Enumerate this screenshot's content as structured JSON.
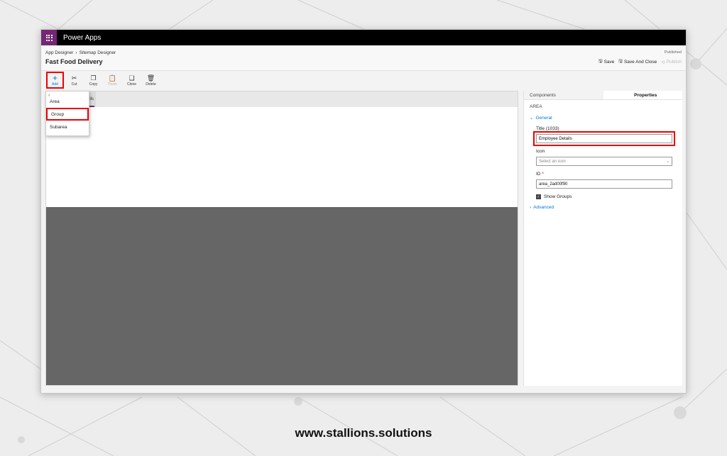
{
  "app": {
    "name": "Power Apps"
  },
  "header": {
    "breadcrumb": [
      "App Designer",
      "Sitemap Designer"
    ],
    "title": "Fast Food Delivery",
    "status": "Published",
    "actions": {
      "save": "Save",
      "save_and_close": "Save And Close",
      "publish": "Publish"
    }
  },
  "toolbar": {
    "add": "Add",
    "cut": "Cut",
    "copy": "Copy",
    "paste": "Paste",
    "clone": "Clone",
    "delete": "Delete"
  },
  "add_menu": {
    "items": [
      "Area",
      "Group",
      "Subarea"
    ],
    "highlighted": "Group"
  },
  "canvas": {
    "area_tile_label": "ils"
  },
  "properties_panel": {
    "tabs": [
      "Components",
      "Properties"
    ],
    "active_tab": "Properties",
    "heading": "AREA",
    "general_section": "General",
    "title_label": "Title (1033)",
    "title_value": "Employee Details",
    "icon_label": "Icon",
    "icon_placeholder": "Select an icon",
    "id_label": "ID",
    "id_required": "*",
    "id_value": "area_2ad00f90",
    "show_groups_label": "Show Groups",
    "show_groups_checked": true,
    "advanced_section": "Advanced"
  },
  "watermark": "www.stallions.solutions",
  "colors": {
    "brand": "#742774",
    "accent": "#0078d4",
    "highlight": "#ee0000"
  }
}
